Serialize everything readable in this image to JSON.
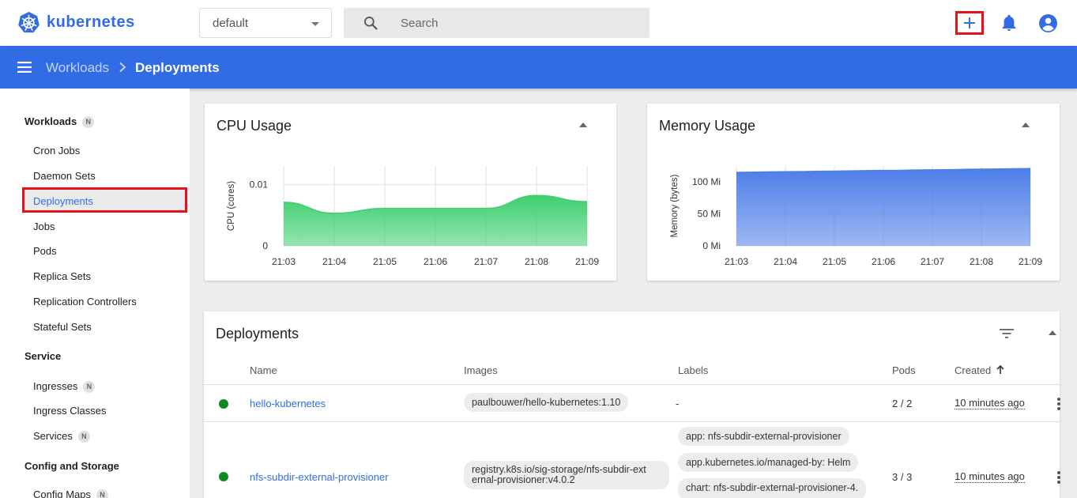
{
  "topbar": {
    "brand": "kubernetes",
    "namespace": "default",
    "search_placeholder": "Search"
  },
  "header": {
    "breadcrumb_parent": "Workloads",
    "breadcrumb_separator": ">",
    "breadcrumb_current": "Deployments"
  },
  "sidebar": {
    "workloads_title": "Workloads",
    "workloads_badge": "N",
    "items": {
      "cron_jobs": "Cron Jobs",
      "daemon_sets": "Daemon Sets",
      "deployments": "Deployments",
      "jobs": "Jobs",
      "pods": "Pods",
      "replica_sets": "Replica Sets",
      "replication_controllers": "Replication Controllers",
      "stateful_sets": "Stateful Sets"
    },
    "service_title": "Service",
    "service_items": {
      "ingresses": "Ingresses",
      "ingresses_badge": "N",
      "ingress_classes": "Ingress Classes",
      "services": "Services",
      "services_badge": "N"
    },
    "config_title": "Config and Storage",
    "config_items": {
      "config_maps": "Config Maps",
      "config_maps_badge": "N"
    }
  },
  "cpu_card": {
    "title": "CPU Usage"
  },
  "memory_card": {
    "title": "Memory Usage"
  },
  "chart_data": [
    {
      "type": "area",
      "title": "CPU Usage",
      "ylabel": "CPU (cores)",
      "xlabel": "",
      "x": [
        "21:03",
        "21:04",
        "21:05",
        "21:06",
        "21:07",
        "21:08",
        "21:09"
      ],
      "y_ticks": [
        "0",
        "0.01"
      ],
      "ylim": [
        0,
        0.013
      ],
      "series": [
        {
          "values": [
            0.0071,
            0.0053,
            0.0061,
            0.0061,
            0.0061,
            0.0082,
            0.0072
          ]
        }
      ],
      "color": "#3ecf6e",
      "grid": true
    },
    {
      "type": "area",
      "title": "Memory Usage",
      "ylabel": "Memory (bytes)",
      "xlabel": "",
      "x": [
        "21:03",
        "21:04",
        "21:05",
        "21:06",
        "21:07",
        "21:08",
        "21:09"
      ],
      "y_ticks": [
        "0 Mi",
        "50 Mi",
        "100 Mi"
      ],
      "ylim": [
        0,
        125
      ],
      "series": [
        {
          "values": [
            115,
            116,
            117,
            118,
            119,
            120,
            121
          ]
        }
      ],
      "color": "#4d7ee8",
      "grid": true
    }
  ],
  "deployments": {
    "title": "Deployments",
    "columns": {
      "name": "Name",
      "images": "Images",
      "labels": "Labels",
      "pods": "Pods",
      "created": "Created"
    },
    "rows": [
      {
        "name": "hello-kubernetes",
        "image": "paulbouwer/hello-kubernetes:1.10",
        "labels": "-",
        "pods": "2 / 2",
        "created": "10 minutes ago"
      },
      {
        "name": "nfs-subdir-external-provisioner",
        "image": "registry.k8s.io/sig-storage/nfs-subdir-external-provisioner:v4.0.2",
        "image_line1": "registry.k8s.io/sig-storage/nfs-subdir-ext",
        "image_line2": "ernal-provisioner:v4.0.2",
        "label_1": "app: nfs-subdir-external-provisioner",
        "label_2": "app.kubernetes.io/managed-by: Helm",
        "label_3": "chart: nfs-subdir-external-provisioner-4.",
        "pods": "3 / 3",
        "created": "10 minutes ago"
      }
    ]
  }
}
